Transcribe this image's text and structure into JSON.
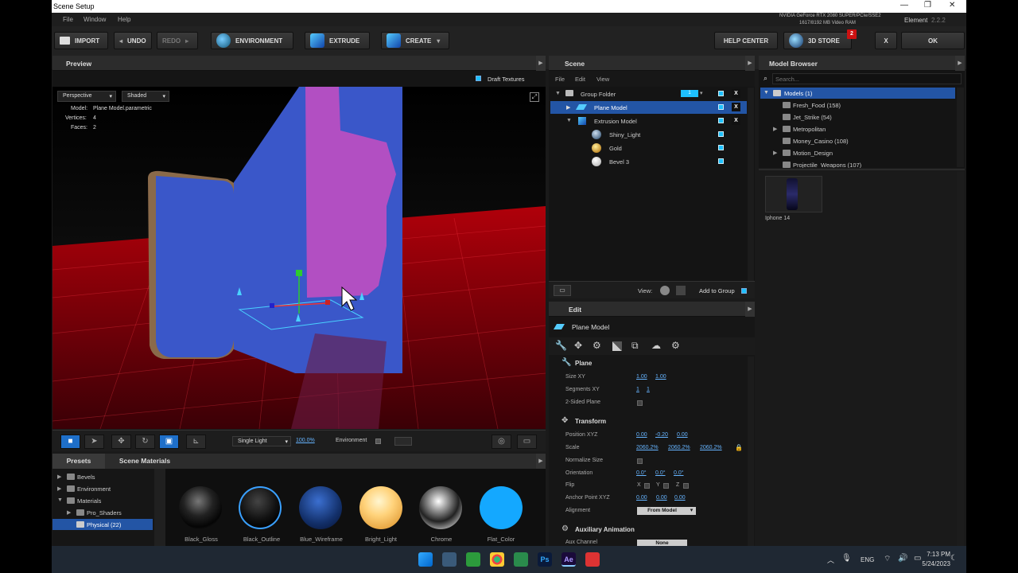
{
  "window": {
    "title": "Scene Setup",
    "controls": [
      "—",
      "❐",
      "✕"
    ]
  },
  "menubar": {
    "items": [
      "File",
      "Window",
      "Help"
    ],
    "element_label": "Element",
    "element_version": "2.2.2"
  },
  "gpu": {
    "line1": "NVIDIA GeForce RTX 2080 SUPER/PCIe/SSE2",
    "line2": "1617/8192 MB Video RAM"
  },
  "toolbar": {
    "import": "IMPORT",
    "undo": "UNDO",
    "redo": "REDO",
    "environment": "ENVIRONMENT",
    "extrude": "EXTRUDE",
    "create": "CREATE",
    "help_center": "HELP CENTER",
    "store": "3D STORE",
    "store_badge": "2",
    "close": "X",
    "ok": "OK"
  },
  "preview": {
    "header": "Preview",
    "draft_textures": "Draft Textures",
    "camera": "Perspective",
    "shading": "Shaded",
    "info": {
      "model_label": "Model:",
      "model_value": "Plane Model.parametric",
      "vertices_label": "Vertices:",
      "vertices_value": "4",
      "faces_label": "Faces:",
      "faces_value": "2"
    },
    "light_mode": "Single Light",
    "light_value": "100.0%",
    "environment_label": "Environment"
  },
  "scene": {
    "header": "Scene",
    "menu": [
      "File",
      "Edit",
      "View"
    ],
    "items": [
      {
        "name": "Group Folder",
        "group_index": "1"
      },
      {
        "name": "Plane Model"
      },
      {
        "name": "Extrusion Model"
      },
      {
        "name": "Shiny_Light"
      },
      {
        "name": "Gold"
      },
      {
        "name": "Bevel 3"
      }
    ],
    "view_label": "View:",
    "add_to_group": "Add to Group"
  },
  "edit": {
    "header": "Edit",
    "object_name": "Plane Model",
    "plane_section": "Plane",
    "size_xy_label": "Size XY",
    "size_x": "1.00",
    "size_y": "1.00",
    "segments_label": "Segments XY",
    "seg_x": "1",
    "seg_y": "1",
    "two_sided_label": "2-Sided Plane",
    "transform_section": "Transform",
    "position_label": "Position XYZ",
    "pos_x": "0.00",
    "pos_y": "-0.20",
    "pos_z": "0.00",
    "scale_label": "Scale",
    "scale_x": "2060.2%",
    "scale_y": "2060.2%",
    "scale_z": "2060.2%",
    "normalize_label": "Normalize Size",
    "orientation_label": "Orientation",
    "ori_x": "0.0°",
    "ori_y": "0.0°",
    "ori_z": "0.0°",
    "flip_label": "Flip",
    "flip_x": "X",
    "flip_y": "Y",
    "flip_z": "Z",
    "anchor_label": "Anchor Point XYZ",
    "anc_x": "0.00",
    "anc_y": "0.00",
    "anc_z": "0.00",
    "alignment_label": "Alignment",
    "alignment_value": "From Model",
    "aux_section": "Auxiliary Animation",
    "aux_channel_label": "Aux Channel",
    "aux_channel_value": "None"
  },
  "model_browser": {
    "header": "Model Browser",
    "search_placeholder": "Search...",
    "tree": [
      {
        "name": "Models (1)"
      },
      {
        "name": "Fresh_Food (158)"
      },
      {
        "name": "Jet_Strike (54)"
      },
      {
        "name": "Metropolitan"
      },
      {
        "name": "Money_Casino (108)"
      },
      {
        "name": "Motion_Design"
      },
      {
        "name": "Projectile_Weapons (107)"
      }
    ],
    "thumbnail_label": "Iphone 14"
  },
  "presets": {
    "tab_presets": "Presets",
    "tab_scene_materials": "Scene Materials",
    "tree": [
      "Bevels",
      "Environment",
      "Materials",
      "Pro_Shaders",
      "Physical (22)"
    ],
    "materials": [
      "Black_Gloss",
      "Black_Outline",
      "Blue_Wireframe",
      "Bright_Light",
      "Chrome",
      "Flat_Color"
    ]
  },
  "taskbar": {
    "lang": "ENG",
    "time": "7:13 PM",
    "date": "5/24/2023"
  }
}
